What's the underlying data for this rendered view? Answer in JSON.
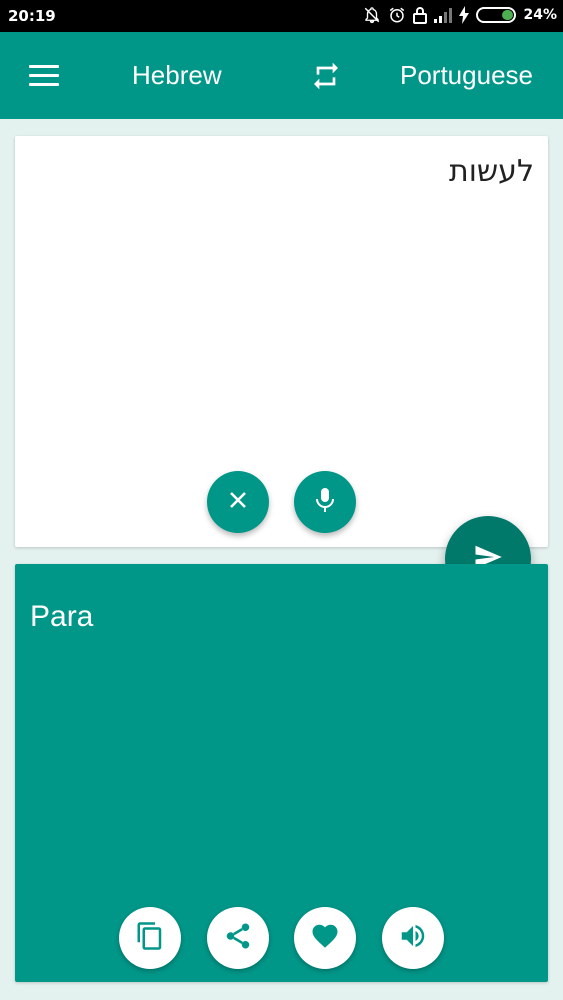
{
  "status_bar": {
    "time": "20:19",
    "battery_percent": "24%",
    "icons": [
      "notifications-off-icon",
      "alarm-icon",
      "lock-icon",
      "signal-icon",
      "charging-icon",
      "battery-icon"
    ]
  },
  "app_bar": {
    "source_language": "Hebrew",
    "target_language": "Portuguese",
    "icons": [
      "menu-icon",
      "swap-languages-icon"
    ]
  },
  "input": {
    "text": "לעשות",
    "actions": [
      "clear-icon",
      "microphone-icon"
    ]
  },
  "translate_action": "send-icon",
  "output": {
    "text": "Para",
    "actions": [
      "copy-icon",
      "share-icon",
      "favorite-icon",
      "speaker-icon"
    ]
  },
  "colors": {
    "primary": "#009688",
    "primary_dark": "#00796b",
    "background": "#e3f1ef",
    "battery": "#4caf50"
  }
}
